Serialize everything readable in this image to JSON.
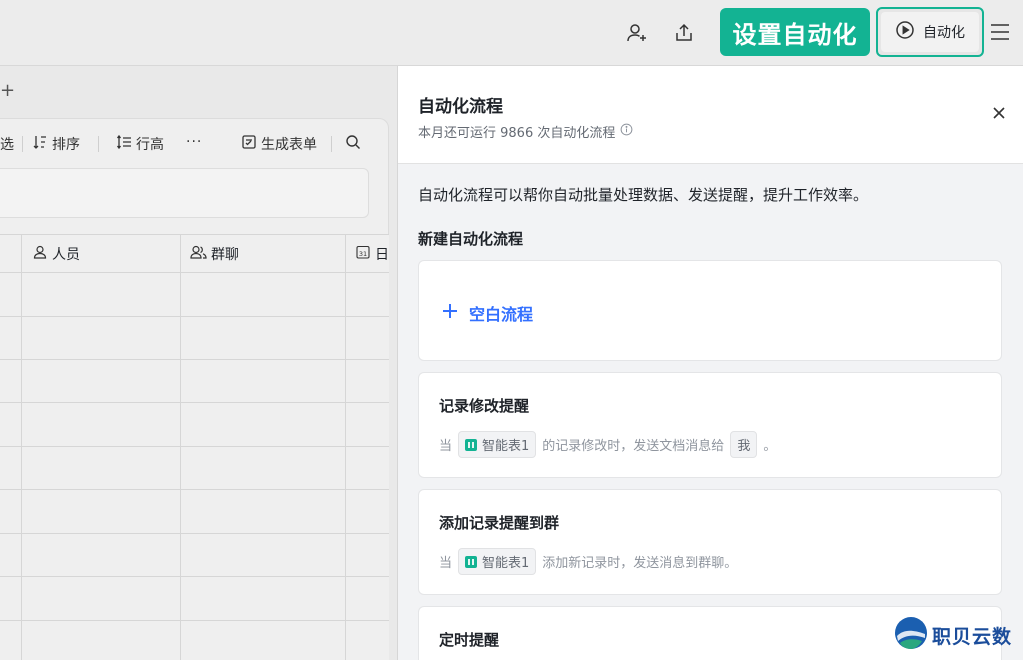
{
  "header": {
    "cta_label": "设置自动化",
    "automation_button_label": "自动化",
    "icons": [
      "add-member-icon",
      "share-icon",
      "play-circle-icon",
      "menu-icon"
    ]
  },
  "sheet": {
    "toolbar": {
      "filter_label": "选",
      "sort_label": "排序",
      "row_height_label": "行高",
      "more_label": "···",
      "form_label": "生成表单"
    },
    "columns": [
      {
        "label": "人员",
        "icon": "person-icon"
      },
      {
        "label": "群聊",
        "icon": "group-icon"
      },
      {
        "label": "日",
        "icon": "calendar-icon"
      }
    ]
  },
  "panel": {
    "title": "自动化流程",
    "subtitle": "本月还可运行 9866 次自动化流程",
    "description": "自动化流程可以帮你自动批量处理数据、发送提醒，提升工作效率。",
    "section_title": "新建自动化流程",
    "blank_flow_label": "空白流程",
    "templates": [
      {
        "title": "记录修改提醒",
        "prefix": "当",
        "table": "智能表1",
        "middle": "的记录修改时，发送文档消息给",
        "recipient": "我",
        "suffix": "。"
      },
      {
        "title": "添加记录提醒到群",
        "prefix": "当",
        "table": "智能表1",
        "middle": "添加新记录时，发送消息到群聊。"
      },
      {
        "title": "定时提醒"
      }
    ]
  },
  "watermark": {
    "text": "职贝云数"
  },
  "colors": {
    "accent": "#13b393",
    "link": "#3370ff"
  }
}
